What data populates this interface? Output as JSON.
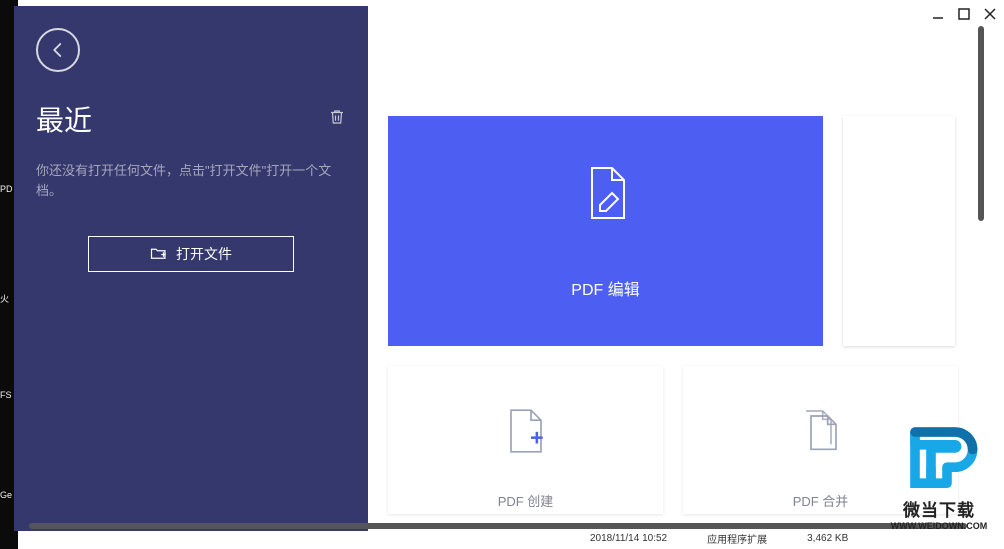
{
  "sidebar": {
    "recent_title": "最近",
    "empty_msg": "你还没有打开任何文件，点击\"打开文件\"打开一个文档。",
    "open_file_label": "打开文件"
  },
  "main": {
    "big_tile_label": "PDF 编辑",
    "tile_create_label": "PDF 创建",
    "tile_merge_label": "PDF 合并"
  },
  "desktop": {
    "l1": "PD",
    "l2": "火",
    "l3": "FS",
    "l4": "Ge"
  },
  "footer": {
    "c1": "2018/11/14 10:52",
    "c2": "应用程序扩展",
    "c3": "3,462 KB"
  },
  "watermark": {
    "line1": "微当下载",
    "line2": "WWW.WEIDOWN.COM"
  }
}
